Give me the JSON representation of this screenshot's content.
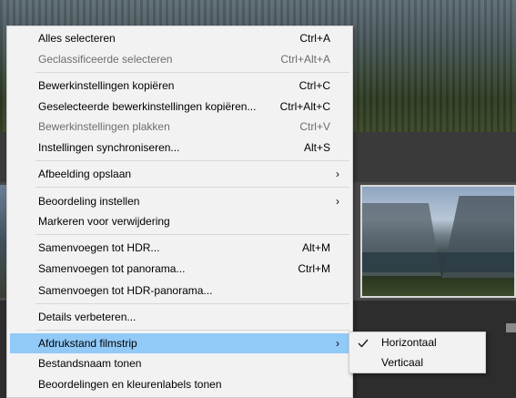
{
  "context_menu": {
    "items": [
      {
        "label": "Alles selecteren",
        "shortcut": "Ctrl+A",
        "enabled": true
      },
      {
        "label": "Geclassificeerde selecteren",
        "shortcut": "Ctrl+Alt+A",
        "enabled": false
      },
      {
        "label": "Bewerkinstellingen kopiëren",
        "shortcut": "Ctrl+C",
        "enabled": true
      },
      {
        "label": "Geselecteerde bewerkinstellingen kopiëren...",
        "shortcut": "Ctrl+Alt+C",
        "enabled": true
      },
      {
        "label": "Bewerkinstellingen plakken",
        "shortcut": "Ctrl+V",
        "enabled": false
      },
      {
        "label": "Instellingen synchroniseren...",
        "shortcut": "Alt+S",
        "enabled": true
      },
      {
        "label": "Afbeelding opslaan",
        "submenu_arrow": "›",
        "enabled": true
      },
      {
        "label": "Beoordeling instellen",
        "submenu_arrow": "›",
        "enabled": true
      },
      {
        "label": "Markeren voor verwijdering",
        "enabled": true
      },
      {
        "label": "Samenvoegen tot HDR...",
        "shortcut": "Alt+M",
        "enabled": true
      },
      {
        "label": "Samenvoegen tot panorama...",
        "shortcut": "Ctrl+M",
        "enabled": true
      },
      {
        "label": "Samenvoegen tot HDR-panorama...",
        "enabled": true
      },
      {
        "label": "Details verbeteren...",
        "enabled": true
      },
      {
        "label": "Afdrukstand filmstrip",
        "submenu_arrow": "›",
        "enabled": true,
        "highlighted": true
      },
      {
        "label": "Bestandsnaam tonen",
        "enabled": true
      },
      {
        "label": "Beoordelingen en kleurenlabels tonen",
        "enabled": true
      }
    ]
  },
  "submenu": {
    "items": [
      {
        "label": "Horizontaal",
        "checked": true
      },
      {
        "label": "Verticaal",
        "checked": false
      }
    ]
  },
  "colors": {
    "menu_bg": "#f2f2f2",
    "highlight": "#91c9f7",
    "disabled_text": "#6d6d6d"
  }
}
